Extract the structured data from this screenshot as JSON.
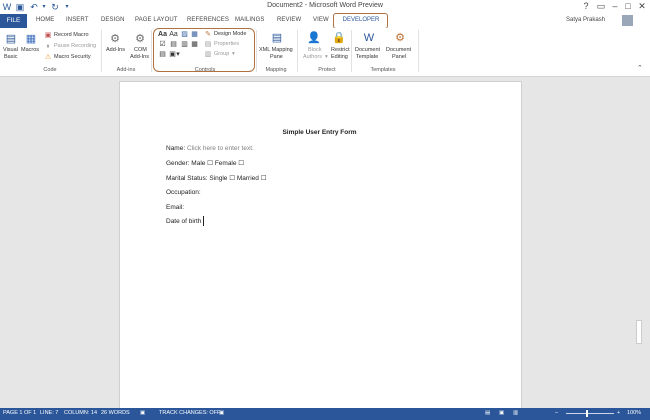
{
  "window": {
    "title": "Document2 - Microsoft Word Preview",
    "help": "?",
    "minimize": "–",
    "restore": "□",
    "close": "✕",
    "user": "Satya Prakash",
    "brand_color": "#2b579a",
    "highlight_color": "#b07040"
  },
  "qat": [
    "word-icon",
    "save-icon",
    "undo-icon",
    "redo-icon",
    "customize-icon"
  ],
  "tabs": {
    "file": "FILE",
    "home": "HOME",
    "insert": "INSERT",
    "design": "DESIGN",
    "page_layout": "PAGE LAYOUT",
    "references": "REFERENCES",
    "mailings": "MAILINGS",
    "review": "REVIEW",
    "view": "VIEW",
    "developer": "DEVELOPER"
  },
  "ribbon": {
    "code": {
      "label": "Code",
      "visual_basic_1": "Visual",
      "visual_basic_2": "Basic",
      "macros": "Macros",
      "record_macro": "Record Macro",
      "pause_recording": "Pause Recording",
      "macro_security": "Macro Security"
    },
    "addins": {
      "label": "Add-ins",
      "addins": "Add-Ins",
      "com_1": "COM",
      "com_2": "Add-Ins"
    },
    "controls": {
      "label": "Controls",
      "design_mode": "Design Mode",
      "properties": "Properties",
      "group": "Group"
    },
    "mapping": {
      "label": "Mapping",
      "xml_1": "XML Mapping",
      "xml_2": "Pane"
    },
    "protect": {
      "label": "Protect",
      "block_1": "Block",
      "block_2": "Authors",
      "restrict_1": "Restrict",
      "restrict_2": "Editing"
    },
    "templates": {
      "label": "Templates",
      "doc_template_1": "Document",
      "doc_template_2": "Template",
      "doc_panel_1": "Document",
      "doc_panel_2": "Panel"
    }
  },
  "document": {
    "title": "Simple User Entry Form",
    "name_label": "Name:",
    "name_placeholder": "Click here to enter text.",
    "gender": "Gender: Male ☐ Female ☐",
    "marital": "Marital Status:  Single ☐ Married ☐",
    "occupation": "Occupation:",
    "email": "Email:",
    "dob": "Date of birth"
  },
  "status": {
    "page": "PAGE 1 OF 1",
    "line": "LINE: 7",
    "column": "COLUMN: 14",
    "words": "26 WORDS",
    "track": "TRACK CHANGES: OFF",
    "zoom": "100%",
    "zoom_minus": "–",
    "zoom_plus": "+"
  }
}
